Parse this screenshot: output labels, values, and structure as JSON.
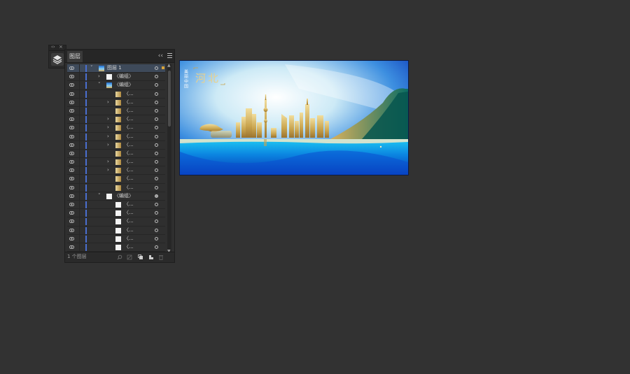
{
  "dock": {
    "grip_left": "‹›",
    "grip_close": "×",
    "layers_icon": "layers-icon"
  },
  "panel": {
    "tab_label": "图层",
    "collapse_label": "‹‹",
    "footer_count": "1 个图层",
    "layer_top": "图层 1",
    "group_label": "〈编组〉",
    "item_label": "〈...",
    "chevron_right": "›",
    "chevron_down": "˅"
  },
  "artboard": {
    "vertical_text": "美丽中国",
    "title_text": "河北"
  },
  "colors": {
    "layer_color": "#4a6fd0",
    "selection_color": "#d9a43a",
    "gold": "#c9a44e",
    "sea_blue": "#0b4fd0"
  }
}
